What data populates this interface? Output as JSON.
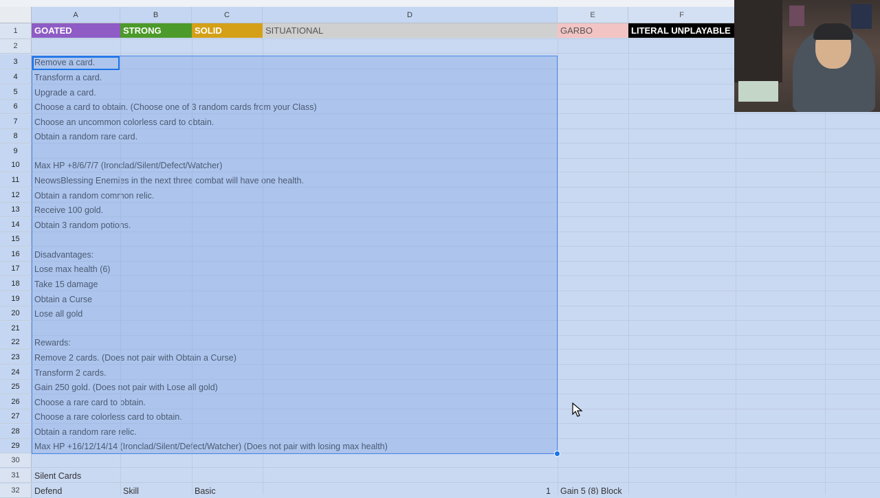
{
  "columns": [
    {
      "letter": "A",
      "selected": true
    },
    {
      "letter": "B",
      "selected": true
    },
    {
      "letter": "C",
      "selected": true
    },
    {
      "letter": "D",
      "selected": true
    },
    {
      "letter": "E",
      "selected": false
    },
    {
      "letter": "F",
      "selected": false
    }
  ],
  "tiers": [
    {
      "label": "GOATED",
      "bg": "#8e5cc4",
      "color": "#ffffff"
    },
    {
      "label": "STRONG",
      "bg": "#4c9a2a",
      "color": "#ffffff"
    },
    {
      "label": "SOLID",
      "bg": "#d4a017",
      "color": "#ffffff"
    },
    {
      "label": "SITUATIONAL",
      "bg": "#d0d0d0",
      "color": "#555555"
    },
    {
      "label": "GARBO",
      "bg": "#f2c4c4",
      "color": "#555555"
    },
    {
      "label": "LITERAL UNPLAYABLE",
      "bg": "#000000",
      "color": "#ffffff"
    }
  ],
  "rows": [
    {
      "num": "1",
      "a": "",
      "b": "",
      "c": "",
      "e": "",
      "f": ""
    },
    {
      "num": "2",
      "a": ""
    },
    {
      "num": "3",
      "a": "Remove a card."
    },
    {
      "num": "4",
      "a": "Transform a card."
    },
    {
      "num": "5",
      "a": "Upgrade a card."
    },
    {
      "num": "6",
      "a": "Choose a card to obtain. (Choose one of 3 random cards from your Class)"
    },
    {
      "num": "7",
      "a": "Choose an uncommon colorless card to obtain."
    },
    {
      "num": "8",
      "a": "Obtain a random rare card."
    },
    {
      "num": "9",
      "a": ""
    },
    {
      "num": "10",
      "a": "Max HP +8/6/7/7 (Ironclad/Silent/Defect/Watcher)"
    },
    {
      "num": "11",
      "a": "NeowsBlessing Enemies in the next three combat will have one health."
    },
    {
      "num": "12",
      "a": "Obtain a random common relic."
    },
    {
      "num": "13",
      "a": "Receive 100 gold."
    },
    {
      "num": "14",
      "a": "Obtain 3 random potions."
    },
    {
      "num": "15",
      "a": ""
    },
    {
      "num": "16",
      "a": "Disadvantages:"
    },
    {
      "num": "17",
      "a": "Lose max health (6)"
    },
    {
      "num": "18",
      "a": "Take 15 damage"
    },
    {
      "num": "19",
      "a": "Obtain a Curse"
    },
    {
      "num": "20",
      "a": "Lose all gold"
    },
    {
      "num": "21",
      "a": ""
    },
    {
      "num": "22",
      "a": "Rewards:"
    },
    {
      "num": "23",
      "a": "Remove 2 cards. (Does not pair with Obtain a Curse)"
    },
    {
      "num": "24",
      "a": "Transform 2 cards."
    },
    {
      "num": "25",
      "a": "Gain 250 gold. (Does not pair with Lose all gold)"
    },
    {
      "num": "26",
      "a": "Choose a rare card to obtain."
    },
    {
      "num": "27",
      "a": "Choose a rare colorless card to obtain."
    },
    {
      "num": "28",
      "a": "Obtain a random rare relic."
    },
    {
      "num": "29",
      "a": "Max HP +16/12/14/14 (Ironclad/Silent/Defect/Watcher) (Does not pair with losing max health)"
    },
    {
      "num": "30",
      "a": ""
    },
    {
      "num": "31",
      "a": "Silent Cards"
    },
    {
      "num": "32",
      "a": "Defend",
      "b": "Skill",
      "c": "Basic",
      "d_num": "1",
      "e": "Gain 5 (8) Block"
    }
  ]
}
